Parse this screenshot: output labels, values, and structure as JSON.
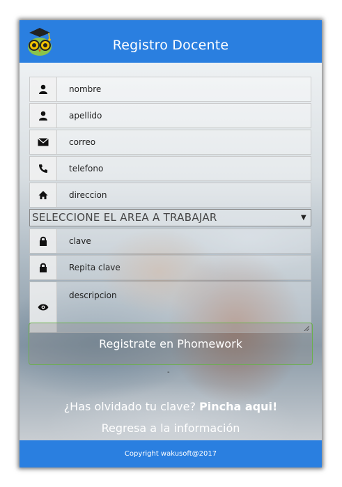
{
  "header": {
    "title": "Registro Docente",
    "logo_icon": "owl-graduate-icon",
    "color": "#2a7fe0"
  },
  "form": {
    "fields": [
      {
        "icon": "user-icon",
        "placeholder": "nombre"
      },
      {
        "icon": "user-icon",
        "placeholder": "apellido"
      },
      {
        "icon": "envelope-icon",
        "placeholder": "correo"
      },
      {
        "icon": "phone-icon",
        "placeholder": "telefono"
      },
      {
        "icon": "home-icon",
        "placeholder": "direccion"
      }
    ],
    "area_select": {
      "selected": "SELECCIONE EL AREA A TRABAJAR"
    },
    "password_fields": [
      {
        "icon": "lock-icon",
        "placeholder": "clave"
      },
      {
        "icon": "lock-icon",
        "placeholder": "Repita clave"
      }
    ],
    "description": {
      "icon": "eye-icon",
      "placeholder": "descripcion"
    },
    "submit_label": "Registrate en Phomework",
    "submit_border_color": "#6ab04c"
  },
  "links": {
    "dash": "-",
    "forgot_prefix": "¿Has olvidado tu clave?",
    "forgot_link": "Pincha aqui!",
    "back": "Regresa a la información"
  },
  "footer": {
    "copyright": "Copyright wakusoft@2017"
  }
}
